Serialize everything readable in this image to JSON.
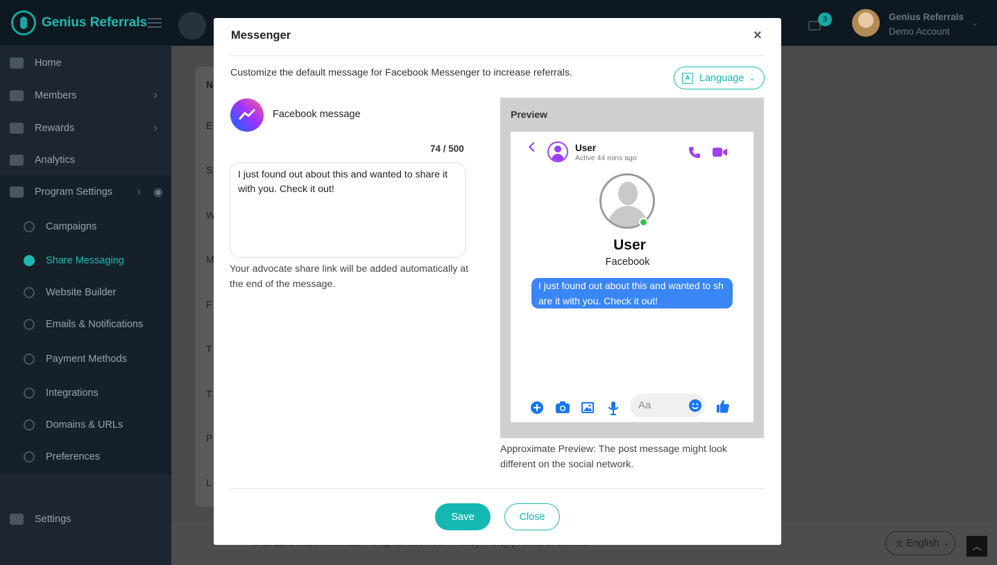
{
  "app": {
    "logo_text": "Genius Referrals",
    "user_name": "Genius Referrals",
    "user_account": "Demo Account",
    "mail_badge": "3"
  },
  "sidebar": {
    "items": [
      {
        "label": "Home",
        "icon": "home-icon"
      },
      {
        "label": "Members",
        "icon": "users-icon"
      },
      {
        "label": "Rewards",
        "icon": "rewards-icon"
      },
      {
        "label": "Analytics",
        "icon": "analytics-icon"
      },
      {
        "label": "Program Settings",
        "icon": "edit-icon"
      },
      {
        "label": "Campaigns",
        "icon": "campaigns-icon"
      },
      {
        "label": "Share Messaging",
        "icon": "share-icon"
      },
      {
        "label": "Website Builder",
        "icon": "palette-icon"
      },
      {
        "label": "Emails & Notifications",
        "icon": "bell-icon"
      },
      {
        "label": "Payment Methods",
        "icon": "sitemap-icon"
      },
      {
        "label": "Integrations",
        "icon": "puzzle-icon"
      },
      {
        "label": "Domains & URLs",
        "icon": "cloud-icon"
      },
      {
        "label": "Preferences",
        "icon": "gear-icon"
      },
      {
        "label": "Settings",
        "icon": "gears-icon"
      }
    ]
  },
  "background": {
    "row_letters": [
      "N",
      "E",
      "S",
      "W",
      "M",
      "F",
      "T",
      "T",
      "P",
      "L"
    ],
    "footer_text": "© 2021 Genius Referrals. All rights reserved. Privacy Policy | Terms of Service",
    "language_label": "English"
  },
  "modal": {
    "title": "Messenger",
    "close_glyph": "×",
    "description": "Customize the default message for Facebook Messenger to increase referrals.",
    "language_button": "Language",
    "network_label": "Facebook message",
    "counter": "74 / 500",
    "message": "I just found out about this and wanted to share it with you. Check it out!",
    "hint": "Your advocate share link will be added automatically at the end of the message.",
    "preview_title": "Preview",
    "preview": {
      "contact_name": "User",
      "contact_status": "Active 44 mins ago",
      "profile_name": "User",
      "profile_sub": "Facebook",
      "bubble_text": "I just found out about this and wanted to sh are it with you. Check it out!",
      "input_placeholder": "Aa"
    },
    "preview_note": "Approximate Preview: The post message might look different on the social network.",
    "save_label": "Save",
    "close_label": "Close"
  },
  "colors": {
    "accent": "#14b8b0",
    "messenger_blue": "#3a86f7",
    "messenger_purple": "#9b3ff5",
    "sidebar_bg": "#1c2530"
  }
}
